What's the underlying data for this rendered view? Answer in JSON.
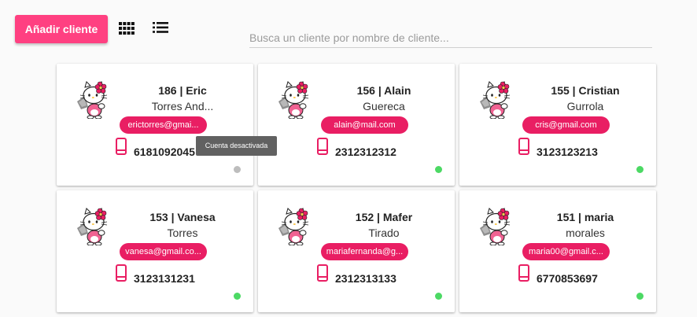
{
  "toolbar": {
    "add_label": "Añadir cliente",
    "grid_icon": "grid-view-icon",
    "list_icon": "list-view-icon"
  },
  "search": {
    "placeholder": "Busca un cliente por nombre de cliente...",
    "value": ""
  },
  "colors": {
    "accent": "#ff4081",
    "chip": "#e91e63",
    "active": "#4cd964",
    "inactive": "#bdbdbd"
  },
  "clients": [
    {
      "title": "186 | Eric",
      "subtitle": "Torres And...",
      "email": "erictorres@gmai...",
      "phone": "6181092045",
      "status": "inactive"
    },
    {
      "title": "156 | Alain",
      "subtitle": "Guereca",
      "email": "alain@mail.com",
      "phone": "2312312312",
      "status": "active"
    },
    {
      "title": "155 | Cristian",
      "subtitle": "Gurrola",
      "email": "cris@gmail.com",
      "phone": "3123123213",
      "status": "active"
    },
    {
      "title": "153 | Vanesa",
      "subtitle": "Torres",
      "email": "vanesa@gmail.co...",
      "phone": "3123131231",
      "status": "active"
    },
    {
      "title": "152 | Mafer",
      "subtitle": "Tirado",
      "email": "mariafernanda@g...",
      "phone": "2312313133",
      "status": "active"
    },
    {
      "title": "151 | maria",
      "subtitle": "morales",
      "email": "maria00@gmail.c...",
      "phone": "6770853697",
      "status": "active"
    }
  ],
  "tooltip": {
    "text": "Cuenta desactivada"
  }
}
